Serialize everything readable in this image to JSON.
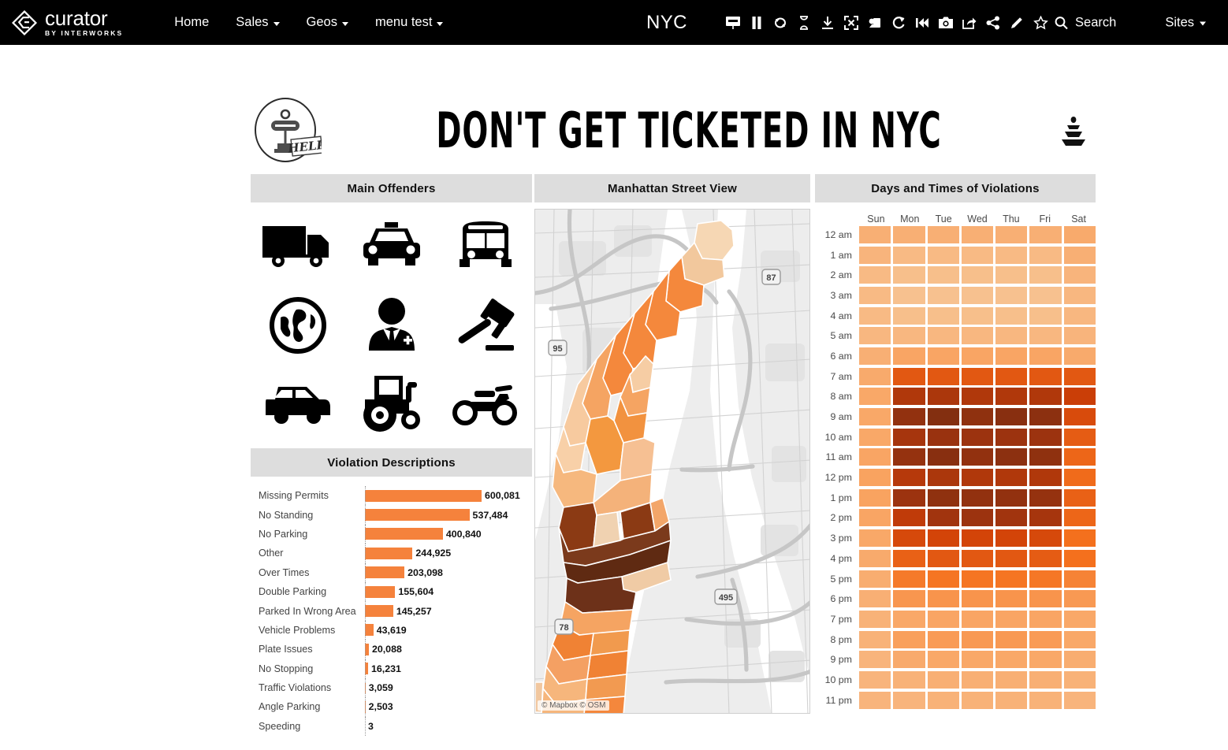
{
  "nav": {
    "brand_name": "curator",
    "brand_sub": "BY INTERWORKS",
    "links": [
      {
        "label": "Home",
        "caret": false
      },
      {
        "label": "Sales",
        "caret": true
      },
      {
        "label": "Geos",
        "caret": true
      },
      {
        "label": "menu test",
        "caret": true
      }
    ],
    "workbook_title": "NYC",
    "tools": [
      "presentation-icon",
      "pause-icon",
      "loop-icon",
      "hourglass-icon",
      "download-icon",
      "fullscreen-icon",
      "highlight-icon",
      "refresh-icon",
      "revert-icon",
      "snapshot-icon",
      "export-icon",
      "share-icon",
      "edit-icon",
      "favorite-icon"
    ],
    "search_label": "Search",
    "sites_label": "Sites"
  },
  "dashboard": {
    "title": "DON'T GET TICKETED IN NYC",
    "help_label": "HELP",
    "panels": {
      "offenders": "Main Offenders",
      "map": "Manhattan Street View",
      "heatmap": "Days and Times of Violations",
      "violations": "Violation Descriptions"
    }
  },
  "offenders": {
    "icons": [
      "truck-icon",
      "taxi-icon",
      "bus-icon",
      "globe-icon",
      "officer-icon",
      "gavel-icon",
      "car-icon",
      "tractor-icon",
      "motorcycle-icon"
    ]
  },
  "map": {
    "attribution": "© Mapbox  © OSM",
    "shields": [
      "95",
      "87",
      "495",
      "78"
    ]
  },
  "colors": {
    "accent": "#f5823c",
    "panel_header": "#dddddd",
    "nav_bg": "#000000",
    "heat_min": "#f6d3ab",
    "heat_max": "#7b2d10"
  },
  "chart_data": [
    {
      "type": "bar",
      "title": "Violation Descriptions",
      "orientation": "horizontal",
      "xlabel": "",
      "ylabel": "",
      "grid": false,
      "categories": [
        "Missing Permits",
        "No Standing",
        "No Parking",
        "Other",
        "Over Times",
        "Double Parking",
        "Parked In Wrong Area",
        "Vehicle Problems",
        "Plate Issues",
        "No Stopping",
        "Traffic Violations",
        "Angle Parking",
        "Speeding"
      ],
      "values": [
        600081,
        537484,
        400840,
        244925,
        203098,
        155604,
        145257,
        43619,
        20088,
        16231,
        3059,
        2503,
        3
      ],
      "labels": [
        "600,081",
        "537,484",
        "400,840",
        "244,925",
        "203,098",
        "155,604",
        "145,257",
        "43,619",
        "20,088",
        "16,231",
        "3,059",
        "2,503",
        "3"
      ],
      "xlim": [
        0,
        600081
      ],
      "color": "#f5823c"
    },
    {
      "type": "heatmap",
      "title": "Days and Times of Violations",
      "xlabel": "",
      "ylabel": "",
      "columns": [
        "Sun",
        "Mon",
        "Tue",
        "Wed",
        "Thu",
        "Fri",
        "Sat"
      ],
      "rows": [
        "12 am",
        "1 am",
        "2 am",
        "3 am",
        "4 am",
        "5 am",
        "6 am",
        "7 am",
        "8 am",
        "9 am",
        "10 am",
        "11 am",
        "12 pm",
        "1 pm",
        "2 pm",
        "3 pm",
        "4 pm",
        "5 pm",
        "6 pm",
        "7 pm",
        "8 pm",
        "9 pm",
        "10 pm",
        "11 pm"
      ],
      "colorscale": [
        "#f6d3ab",
        "#f9a05c",
        "#f4701d",
        "#cf3f06",
        "#9c330f",
        "#7b2d10"
      ],
      "values": [
        [
          0.14,
          0.14,
          0.14,
          0.14,
          0.14,
          0.14,
          0.16
        ],
        [
          0.12,
          0.1,
          0.1,
          0.1,
          0.1,
          0.1,
          0.14
        ],
        [
          0.1,
          0.08,
          0.08,
          0.08,
          0.08,
          0.08,
          0.12
        ],
        [
          0.1,
          0.07,
          0.07,
          0.07,
          0.07,
          0.07,
          0.11
        ],
        [
          0.1,
          0.08,
          0.08,
          0.08,
          0.08,
          0.08,
          0.11
        ],
        [
          0.11,
          0.11,
          0.11,
          0.11,
          0.11,
          0.11,
          0.12
        ],
        [
          0.14,
          0.18,
          0.18,
          0.18,
          0.18,
          0.18,
          0.16
        ],
        [
          0.16,
          0.5,
          0.5,
          0.5,
          0.5,
          0.5,
          0.5
        ],
        [
          0.17,
          0.72,
          0.74,
          0.72,
          0.72,
          0.72,
          0.62
        ],
        [
          0.17,
          0.86,
          0.95,
          0.88,
          0.92,
          0.9,
          0.55
        ],
        [
          0.17,
          0.76,
          0.82,
          0.8,
          0.8,
          0.8,
          0.48
        ],
        [
          0.18,
          0.84,
          0.92,
          0.86,
          0.9,
          0.88,
          0.44
        ],
        [
          0.19,
          0.7,
          0.74,
          0.72,
          0.72,
          0.72,
          0.42
        ],
        [
          0.19,
          0.8,
          0.88,
          0.86,
          0.86,
          0.84,
          0.46
        ],
        [
          0.18,
          0.66,
          0.78,
          0.8,
          0.78,
          0.76,
          0.44
        ],
        [
          0.17,
          0.56,
          0.58,
          0.58,
          0.58,
          0.56,
          0.4
        ],
        [
          0.16,
          0.46,
          0.5,
          0.5,
          0.5,
          0.48,
          0.4
        ],
        [
          0.15,
          0.36,
          0.38,
          0.38,
          0.38,
          0.37,
          0.32
        ],
        [
          0.14,
          0.24,
          0.25,
          0.25,
          0.25,
          0.25,
          0.23
        ],
        [
          0.13,
          0.17,
          0.18,
          0.18,
          0.18,
          0.18,
          0.17
        ],
        [
          0.13,
          0.2,
          0.22,
          0.23,
          0.23,
          0.22,
          0.17
        ],
        [
          0.12,
          0.16,
          0.17,
          0.17,
          0.17,
          0.17,
          0.15
        ],
        [
          0.12,
          0.13,
          0.14,
          0.14,
          0.14,
          0.14,
          0.13
        ],
        [
          0.12,
          0.12,
          0.13,
          0.13,
          0.13,
          0.13,
          0.12
        ]
      ]
    }
  ]
}
